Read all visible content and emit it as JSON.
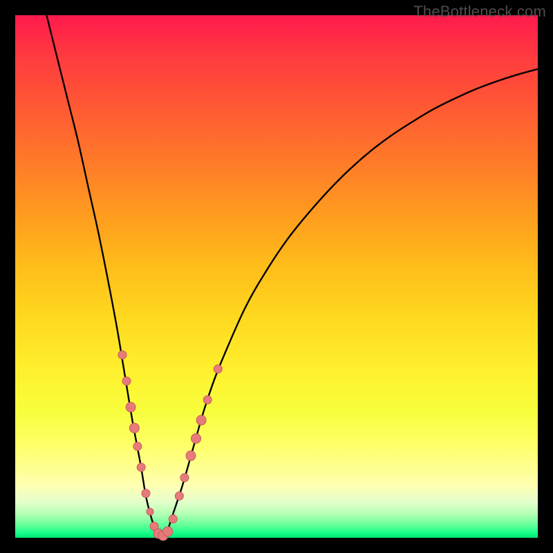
{
  "watermark": "TheBottleneck.com",
  "colors": {
    "curve": "#000000",
    "dot_fill": "#e77b7b",
    "dot_stroke": "#c95a5a",
    "frame": "#000000"
  },
  "chart_data": {
    "type": "line",
    "title": "",
    "xlabel": "",
    "ylabel": "",
    "xlim": [
      0,
      100
    ],
    "ylim": [
      0,
      100
    ],
    "grid": false,
    "legend": false,
    "series": [
      {
        "name": "bottleneck-curve",
        "x": [
          6,
          8,
          10,
          12,
          14,
          16,
          18,
          19.5,
          21,
          22.5,
          24,
          25,
          26,
          27,
          28,
          29,
          30,
          32,
          34,
          36,
          38,
          40,
          44,
          48,
          52,
          56,
          60,
          64,
          68,
          72,
          76,
          80,
          84,
          88,
          92,
          96,
          100
        ],
        "y": [
          100,
          92,
          84,
          76,
          67,
          58,
          48,
          40,
          31,
          22,
          14,
          8,
          4,
          1,
          0,
          1,
          4,
          10,
          17,
          24,
          30,
          35,
          44,
          51,
          57,
          62,
          66.5,
          70.5,
          74,
          77,
          79.6,
          82,
          84,
          85.8,
          87.3,
          88.6,
          89.7
        ]
      }
    ],
    "points": [
      {
        "x": 20.5,
        "y": 35,
        "r": 6
      },
      {
        "x": 21.3,
        "y": 30,
        "r": 6
      },
      {
        "x": 22.1,
        "y": 25,
        "r": 7
      },
      {
        "x": 22.8,
        "y": 21,
        "r": 7
      },
      {
        "x": 23.4,
        "y": 17.5,
        "r": 6
      },
      {
        "x": 24.1,
        "y": 13.5,
        "r": 6
      },
      {
        "x": 25.0,
        "y": 8.5,
        "r": 6
      },
      {
        "x": 25.8,
        "y": 5,
        "r": 5
      },
      {
        "x": 26.6,
        "y": 2.2,
        "r": 6
      },
      {
        "x": 27.4,
        "y": 0.8,
        "r": 7
      },
      {
        "x": 28.3,
        "y": 0.4,
        "r": 7
      },
      {
        "x": 29.2,
        "y": 1.2,
        "r": 7
      },
      {
        "x": 30.2,
        "y": 3.6,
        "r": 6
      },
      {
        "x": 31.4,
        "y": 8,
        "r": 6
      },
      {
        "x": 32.4,
        "y": 11.5,
        "r": 6
      },
      {
        "x": 33.6,
        "y": 15.7,
        "r": 7
      },
      {
        "x": 34.6,
        "y": 19,
        "r": 7
      },
      {
        "x": 35.6,
        "y": 22.5,
        "r": 7
      },
      {
        "x": 36.8,
        "y": 26.4,
        "r": 6
      },
      {
        "x": 38.8,
        "y": 32.3,
        "r": 6
      }
    ],
    "gradient_stops": [
      {
        "pos": 0.0,
        "color": "#ff1a4d"
      },
      {
        "pos": 0.18,
        "color": "#ff5a33"
      },
      {
        "pos": 0.38,
        "color": "#ff9b1f"
      },
      {
        "pos": 0.58,
        "color": "#ffd91f"
      },
      {
        "pos": 0.76,
        "color": "#f7ff3d"
      },
      {
        "pos": 0.9,
        "color": "#ffffb3"
      },
      {
        "pos": 0.97,
        "color": "#66ff99"
      },
      {
        "pos": 1.0,
        "color": "#00e673"
      }
    ]
  }
}
